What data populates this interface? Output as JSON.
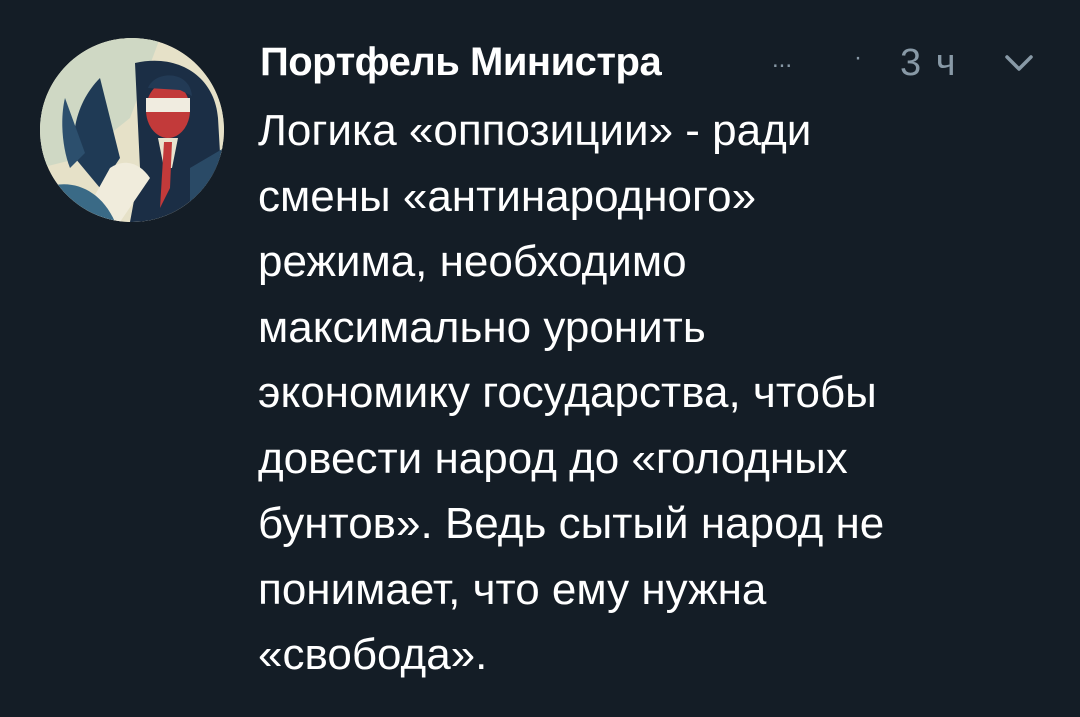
{
  "tweet": {
    "author": {
      "display_name": "Портфель Министра",
      "truncation": "...",
      "avatar_icon": "avatar-portrait-icon"
    },
    "separator": "·",
    "timestamp": "3 ч",
    "menu_icon": "chevron-down-icon",
    "text_lines": [
      "Логика «оппозиции» - ради",
      "смены «антинародного»",
      "режима, необходимо",
      "максимально уронить",
      "экономику государства, чтобы",
      "довести народ до «голодных",
      "бунтов». Ведь сытый народ не",
      "понимает, что ему нужна",
      "«свобода»."
    ]
  },
  "colors": {
    "background": "#141d26",
    "text": "#ffffff",
    "secondary": "#8899a6"
  }
}
